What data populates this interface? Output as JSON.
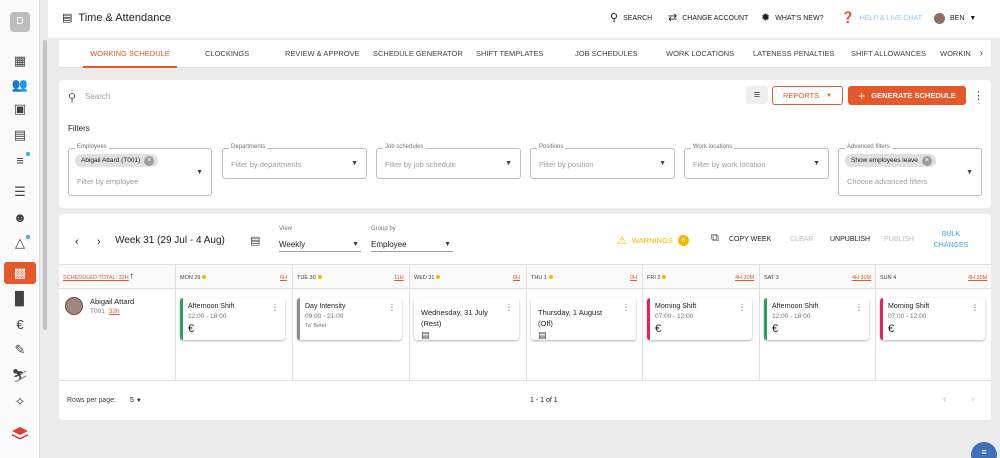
{
  "sidebar": {
    "logo_letter": "D",
    "icons": [
      "dashboard-icon",
      "people-icon",
      "contact-card-icon",
      "calendar-icon",
      "checklist-icon",
      "list-icon",
      "person-voice-icon",
      "warning-icon",
      "attendance-icon",
      "building-icon",
      "euro-icon",
      "rate-review-icon",
      "walk-icon",
      "accessibility-icon",
      "layers-icon"
    ]
  },
  "header": {
    "title": "Time & Attendance",
    "search": "SEARCH",
    "change_account": "CHANGE ACCOUNT",
    "whats_new": "WHAT'S NEW?",
    "help": "HELP & LIVE CHAT",
    "user": "BEN"
  },
  "tabs": [
    "WORKING SCHEDULE",
    "CLOCKINGS",
    "REVIEW & APPROVE",
    "SCHEDULE GENERATOR",
    "SHIFT TEMPLATES",
    "JOB SCHEDULES",
    "WORK LOCATIONS",
    "LATENESS PENALTIES",
    "SHIFT ALLOWANCES",
    "WORKIN"
  ],
  "toolbar": {
    "search_placeholder": "Search",
    "reports_label": "REPORTS",
    "generate_label": "GENERATE SCHEDULE"
  },
  "filters": {
    "title": "Filters",
    "employees": {
      "label": "Employees",
      "chip": "Abigail Attard (T001)",
      "placeholder": "Filter by employee"
    },
    "departments": {
      "label": "Departments",
      "placeholder": "Filter by departments"
    },
    "job_schedules": {
      "label": "Job schedules",
      "placeholder": "Filter by job schedule"
    },
    "positions": {
      "label": "Positions",
      "placeholder": "Filter by position"
    },
    "work_locations": {
      "label": "Work locations",
      "placeholder": "Filter by work location"
    },
    "advanced": {
      "label": "Advanced filters",
      "chip": "Show employees leave",
      "placeholder": "Choose advanced filters"
    }
  },
  "schedule": {
    "week_label": "Week 31 (29 Jul - 4 Aug)",
    "view": {
      "label": "View",
      "value": "Weekly"
    },
    "group_by": {
      "label": "Group by",
      "value": "Employee"
    },
    "warnings_label": "WARNINGS",
    "warnings_count": "6",
    "copy_week": "COPY WEEK",
    "clear": "CLEAR",
    "unpublish": "UNPUBLISH",
    "publish": "PUBLISH",
    "bulk_changes": "BULK CHANGES",
    "scheduled_total": "SCHEDULED TOTAL: 32H",
    "days": [
      {
        "label": "MON 29",
        "total": "6H",
        "warn": true
      },
      {
        "label": "TUE 30",
        "total": "11H",
        "warn": true
      },
      {
        "label": "WED 31",
        "total": "0H",
        "warn": true
      },
      {
        "label": "THU 1",
        "total": "0H",
        "warn": true
      },
      {
        "label": "FRI 2",
        "total": "4H 30M",
        "warn": true
      },
      {
        "label": "SAT 3",
        "total": "4H 30M",
        "warn": false
      },
      {
        "label": "SUN 4",
        "total": "4H 30M",
        "warn": false
      }
    ],
    "employee": {
      "name": "Abigail Attard",
      "code": "T001",
      "hours": "32h"
    },
    "shifts": [
      {
        "title": "Afternoon Shift",
        "hours": "12:00 - 18:00",
        "color": "#2e9e5b"
      },
      {
        "title": "Day Intensity",
        "hours": "09:00 - 21:00",
        "location": "Ta' Betel",
        "color": "#8d8d8d"
      },
      {
        "title": "Wednesday, 31 July\n(Rest)"
      },
      {
        "title": "Thursday, 1 August\n(Off)"
      },
      {
        "title": "Morning Shift",
        "hours": "07:00 - 12:00",
        "color": "#e91e63"
      },
      {
        "title": "Afternoon Shift",
        "hours": "12:00 - 18:00",
        "color": "#2e9e5b"
      },
      {
        "title": "Morning Shift",
        "hours": "07:00 - 12:00",
        "color": "#e91e63"
      }
    ],
    "rows_per_page_label": "Rows per page:",
    "rows_per_page": "5",
    "pagination": "1 - 1 of 1"
  },
  "colors": {
    "accent": "#e4582a",
    "warning": "#f5b800",
    "link": "#42a5f5"
  }
}
